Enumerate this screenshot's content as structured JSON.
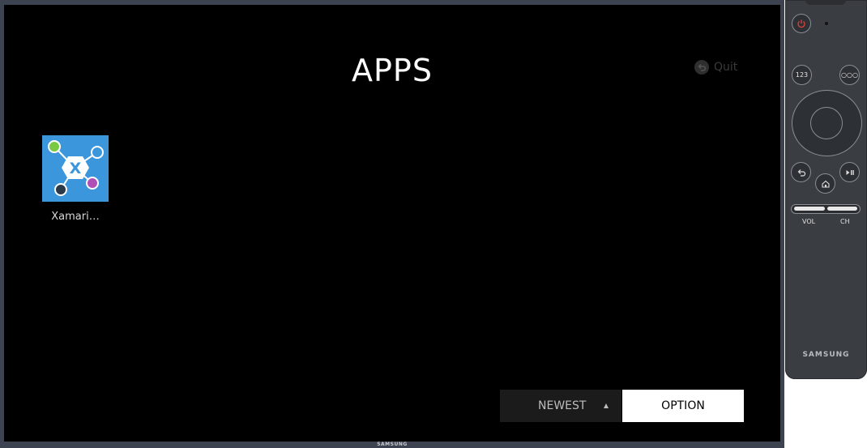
{
  "screen": {
    "title": "APPS",
    "quit_label": "Quit",
    "apps": [
      {
        "label": "Xamari…",
        "icon": "xamarin-icon"
      }
    ],
    "sort": {
      "label": "NEWEST",
      "icon": "triangle-up-icon"
    },
    "option_label": "OPTION",
    "tv_brand": "SAMSUNG"
  },
  "remote": {
    "btn_123": "123",
    "btn_more": "○○○",
    "vol_label": "VOL",
    "ch_label": "CH",
    "brand": "SAMSUNG",
    "icons": [
      "power-icon",
      "back-icon",
      "home-icon",
      "play-pause-icon"
    ]
  },
  "colors": {
    "screen_bg": "#000000",
    "app_icon_bg": "#3b96dc",
    "option_bg": "#ffffff",
    "power_red": "#e0403a"
  }
}
